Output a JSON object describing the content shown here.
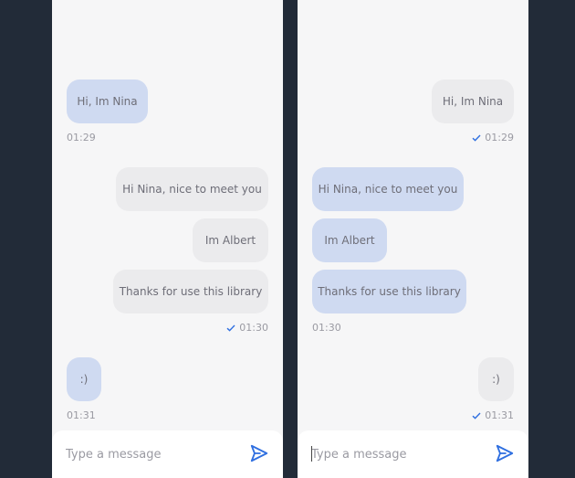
{
  "left_chat": {
    "messages": [
      {
        "text": "Hi, Im Nina"
      },
      {
        "text": "Hi Nina, nice to meet you"
      },
      {
        "text": "Im Albert"
      },
      {
        "text": "Thanks for use this library"
      },
      {
        "text": ":)"
      }
    ],
    "times": [
      "01:29",
      "01:30",
      "01:31"
    ],
    "composer": {
      "placeholder": "Type a message"
    }
  },
  "right_chat": {
    "messages": [
      {
        "text": "Hi, Im Nina"
      },
      {
        "text": "Hi Nina, nice to meet you"
      },
      {
        "text": "Im Albert"
      },
      {
        "text": "Thanks for use this library"
      },
      {
        "text": ":)"
      }
    ],
    "times": [
      "01:29",
      "01:30",
      "01:31"
    ],
    "composer": {
      "placeholder": "Type a message"
    }
  },
  "colors": {
    "background": "#222b38",
    "panel": "#f6f6f7",
    "incoming_bubble": "#cfdaf1",
    "outgoing_bubble": "#ebebed",
    "accent": "#2f6fe0"
  },
  "icons": {
    "send": "send-icon",
    "read_check": "check-icon"
  }
}
